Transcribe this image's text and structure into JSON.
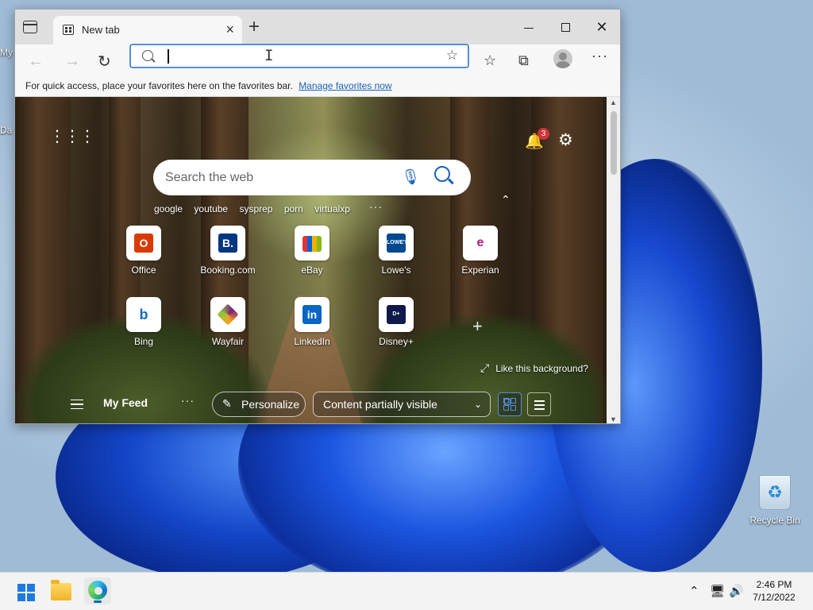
{
  "desktop": {
    "labels": [
      "My",
      "Da"
    ],
    "recycle_bin": "Recycle Bin"
  },
  "browser": {
    "tab_title": "New tab",
    "tab_close": "×",
    "new_tab": "+",
    "favbar": {
      "hint": "For quick access, place your favorites here on the favorites bar.",
      "link": "Manage favorites now"
    }
  },
  "newtab": {
    "search_placeholder": "Search the web",
    "quick_searches": [
      "google",
      "youtube",
      "sysprep",
      "porn",
      "virtualxp"
    ],
    "notification_count": "3",
    "tiles": [
      {
        "label": "Office",
        "color": "#d83b01"
      },
      {
        "label": "Booking.com",
        "color": "#003580"
      },
      {
        "label": "eBay",
        "color": "#e53238"
      },
      {
        "label": "Lowe's",
        "color": "#004990"
      },
      {
        "label": "Experian",
        "color": "#af1685"
      },
      {
        "label": "Bing",
        "color": "#0f6cbd"
      },
      {
        "label": "Wayfair",
        "color": "#7f187f"
      },
      {
        "label": "LinkedIn",
        "color": "#0a66c2"
      },
      {
        "label": "Disney+",
        "color": "#0e1a4a"
      }
    ],
    "add_tile": "+",
    "like_background": "Like this background?",
    "feed": {
      "title": "My Feed",
      "personalize": "Personalize",
      "content_visibility": "Content partially visible"
    }
  },
  "taskbar": {
    "time": "2:46 PM",
    "date": "7/12/2022"
  },
  "colors": {
    "accent": "#1a63b8",
    "badge": "#d13438",
    "start_blue": "#1e7ae0"
  }
}
